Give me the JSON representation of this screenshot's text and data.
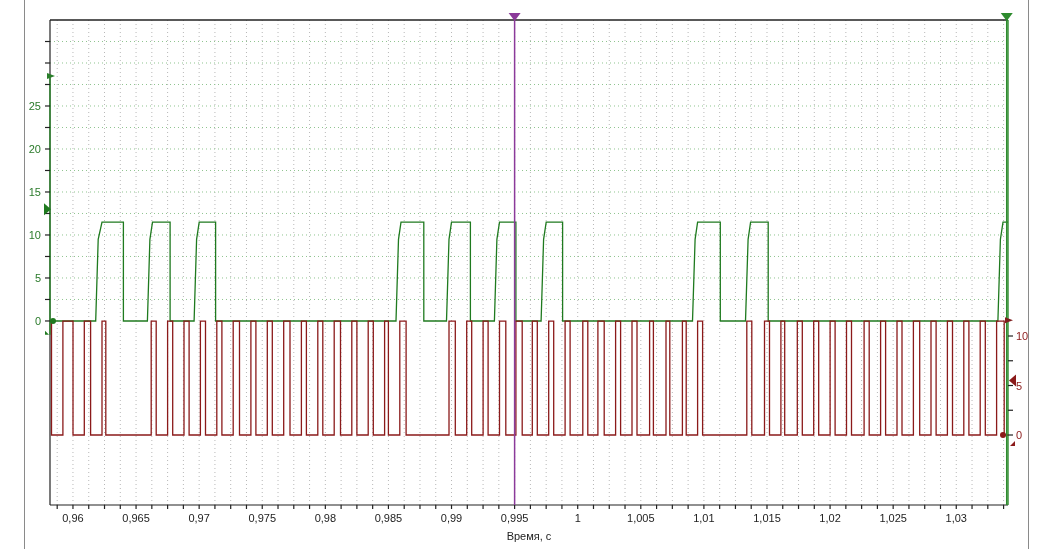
{
  "chart_data": {
    "type": "line",
    "xlabel": "Время, с",
    "xlim": [
      0.95818,
      1.0341
    ],
    "ylim": [
      -21.4,
      35
    ],
    "y2lim": [
      -7.07,
      41.92
    ],
    "xticks": [
      {
        "value": 0.96,
        "label": "0,96"
      },
      {
        "value": 0.965,
        "label": "0,965"
      },
      {
        "value": 0.97,
        "label": "0,97"
      },
      {
        "value": 0.975,
        "label": "0,975"
      },
      {
        "value": 0.98,
        "label": "0,98"
      },
      {
        "value": 0.985,
        "label": "0,985"
      },
      {
        "value": 0.99,
        "label": "0,99"
      },
      {
        "value": 0.995,
        "label": "0,995"
      },
      {
        "value": 1,
        "label": "1"
      },
      {
        "value": 1.005,
        "label": "1,005"
      },
      {
        "value": 1.01,
        "label": "1,01"
      },
      {
        "value": 1.015,
        "label": "1,015"
      },
      {
        "value": 1.02,
        "label": "1,02"
      },
      {
        "value": 1.025,
        "label": "1,025"
      },
      {
        "value": 1.03,
        "label": "1,03"
      }
    ],
    "yticks": [
      0,
      5,
      10,
      15,
      20,
      25
    ],
    "y2ticks": [
      0,
      5,
      10
    ],
    "series": [
      {
        "color": "#1f7a1f",
        "x": [
          0.9582,
          0.9618,
          0.962,
          0.9623,
          0.964,
          0.964,
          0.9659,
          0.9661,
          0.9663,
          0.9677,
          0.9677,
          0.9696,
          0.9698,
          0.97,
          0.9713,
          0.9713,
          0.9856,
          0.9858,
          0.986,
          0.9878,
          0.9878,
          0.9896,
          0.9898,
          0.99,
          0.9915,
          0.9915,
          0.9934,
          0.9936,
          0.9938,
          0.9951,
          0.9951,
          0.9971,
          0.9973,
          0.9975,
          0.9988,
          0.9988,
          1.0091,
          1.0093,
          1.0095,
          1.0113,
          1.0113,
          1.0133,
          1.0135,
          1.0137,
          1.0151,
          1.0151,
          1.0333,
          1.0335,
          1.0337,
          1.0341
        ],
        "values": [
          0,
          0,
          9.5,
          11.5,
          11.5,
          0,
          0,
          9.5,
          11.5,
          11.5,
          0,
          0,
          9.5,
          11.5,
          11.5,
          0,
          0,
          9.5,
          11.5,
          11.5,
          0,
          0,
          9.5,
          11.5,
          11.5,
          0,
          0,
          9.5,
          11.5,
          11.5,
          0,
          0,
          9.5,
          11.5,
          11.5,
          0,
          0,
          9.5,
          11.5,
          11.5,
          0,
          0,
          9.5,
          11.5,
          11.5,
          0,
          0,
          9.5,
          11.5,
          11.5
        ]
      },
      {
        "color": "#8b1a1a",
        "axis": "y2",
        "x": [
          0.9582,
          0.9583,
          0.9583,
          0.9592,
          0.9592,
          0.96,
          0.96,
          0.9609,
          0.9609,
          0.9614,
          0.9614,
          0.9623,
          0.9623,
          0.9626,
          0.9626,
          0.9662,
          0.9662,
          0.9666,
          0.9666,
          0.9675,
          0.9675,
          0.9679,
          0.9679,
          0.9688,
          0.9688,
          0.9692,
          0.9692,
          0.9701,
          0.9701,
          0.9705,
          0.9705,
          0.9714,
          0.9714,
          0.9718,
          0.9718,
          0.9727,
          0.9727,
          0.9732,
          0.9732,
          0.9741,
          0.9741,
          0.9745,
          0.9745,
          0.9754,
          0.9754,
          0.9758,
          0.9758,
          0.9767,
          0.9767,
          0.9772,
          0.9772,
          0.9781,
          0.9781,
          0.9785,
          0.9785,
          0.9794,
          0.9794,
          0.9798,
          0.9798,
          0.9807,
          0.9807,
          0.9812,
          0.9812,
          0.9821,
          0.9821,
          0.9825,
          0.9825,
          0.9834,
          0.9834,
          0.9838,
          0.9838,
          0.9847,
          0.9847,
          0.985,
          0.985,
          0.9859,
          0.9859,
          0.9864,
          0.9864,
          0.9898,
          0.9898,
          0.9903,
          0.9903,
          0.9912,
          0.9912,
          0.9916,
          0.9916,
          0.9925,
          0.9925,
          0.9929,
          0.9929,
          0.9938,
          0.9938,
          0.9943,
          0.9943,
          0.9951,
          0.9951,
          0.9956,
          0.9956,
          0.9964,
          0.9964,
          0.9968,
          0.9968,
          0.9977,
          0.9977,
          0.9981,
          0.9981,
          0.999,
          0.999,
          0.9994,
          0.9994,
          1.0004,
          1.0004,
          1.0008,
          1.0008,
          1.0016,
          1.0016,
          1.0021,
          1.0021,
          1.003,
          1.003,
          1.0034,
          1.0034,
          1.0043,
          1.0043,
          1.0047,
          1.0047,
          1.0057,
          1.0057,
          1.006,
          1.006,
          1.007,
          1.007,
          1.0073,
          1.0073,
          1.0083,
          1.0083,
          1.0086,
          1.0086,
          1.0095,
          1.0095,
          1.0099,
          1.0099,
          1.0134,
          1.0134,
          1.0138,
          1.0138,
          1.0148,
          1.0148,
          1.0152,
          1.0152,
          1.0161,
          1.0161,
          1.0164,
          1.0164,
          1.0174,
          1.0174,
          1.0178,
          1.0178,
          1.0187,
          1.0187,
          1.0191,
          1.0191,
          1.02,
          1.02,
          1.0204,
          1.0204,
          1.0213,
          1.0213,
          1.0217,
          1.0217,
          1.0227,
          1.0227,
          1.0231,
          1.0231,
          1.024,
          1.024,
          1.0244,
          1.0244,
          1.0253,
          1.0253,
          1.0257,
          1.0257,
          1.0266,
          1.0266,
          1.0271,
          1.0271,
          1.028,
          1.028,
          1.0284,
          1.0284,
          1.0293,
          1.0293,
          1.0297,
          1.0297,
          1.0306,
          1.0306,
          1.031,
          1.031,
          1.0319,
          1.0319,
          1.0323,
          1.0323,
          1.0332,
          1.0332,
          1.0338,
          1.0338,
          1.0341
        ],
        "values": [
          11.5,
          11.5,
          0,
          0,
          11.5,
          11.5,
          0,
          0,
          11.5,
          11.5,
          0,
          0,
          11.5,
          11.5,
          0,
          0,
          11.5,
          11.5,
          0,
          0,
          11.5,
          11.5,
          0,
          0,
          11.5,
          11.5,
          0,
          0,
          11.5,
          11.5,
          0,
          0,
          11.5,
          11.5,
          0,
          0,
          11.5,
          11.5,
          0,
          0,
          11.5,
          11.5,
          0,
          0,
          11.5,
          11.5,
          0,
          0,
          11.5,
          11.5,
          0,
          0,
          11.5,
          11.5,
          0,
          0,
          11.5,
          11.5,
          0,
          0,
          11.5,
          11.5,
          0,
          0,
          11.5,
          11.5,
          0,
          0,
          11.5,
          11.5,
          0,
          0,
          11.5,
          11.5,
          0,
          0,
          11.5,
          11.5,
          0,
          0,
          11.5,
          11.5,
          0,
          0,
          11.5,
          11.5,
          0,
          0,
          11.5,
          11.5,
          0,
          0,
          11.5,
          11.5,
          0,
          0,
          11.5,
          11.5,
          0,
          0,
          11.5,
          11.5,
          0,
          0,
          11.5,
          11.5,
          0,
          0,
          11.5,
          11.5,
          0,
          0,
          11.5,
          11.5,
          0,
          0,
          11.5,
          11.5,
          0,
          0,
          11.5,
          11.5,
          0,
          0,
          11.5,
          11.5,
          0,
          0,
          11.5,
          11.5,
          0,
          0,
          11.5,
          11.5,
          0,
          0,
          11.5,
          11.5,
          0,
          0,
          11.5,
          11.5,
          0,
          0,
          11.5,
          11.5,
          0,
          0,
          11.5,
          11.5,
          0,
          0,
          11.5,
          11.5,
          0,
          0,
          11.5,
          11.5,
          0,
          0,
          11.5,
          11.5,
          0,
          0,
          11.5,
          11.5,
          0,
          0,
          11.5,
          11.5,
          0,
          0,
          11.5,
          11.5,
          0,
          0,
          11.5,
          11.5,
          0,
          0,
          11.5,
          11.5,
          0,
          0,
          11.5,
          11.5,
          0,
          0,
          11.5,
          11.5,
          0,
          0,
          11.5,
          11.5,
          0,
          0,
          11.5,
          11.5,
          0,
          0,
          11.5,
          11.5,
          0,
          0,
          11.5,
          11.5,
          0,
          0
        ]
      }
    ],
    "grid": true,
    "ref_lines": [
      {
        "axis": "x",
        "value": 0.995,
        "color": "#8b3a9a"
      },
      {
        "axis": "x",
        "value": 1.034,
        "color": "#2e8b2e"
      }
    ]
  }
}
